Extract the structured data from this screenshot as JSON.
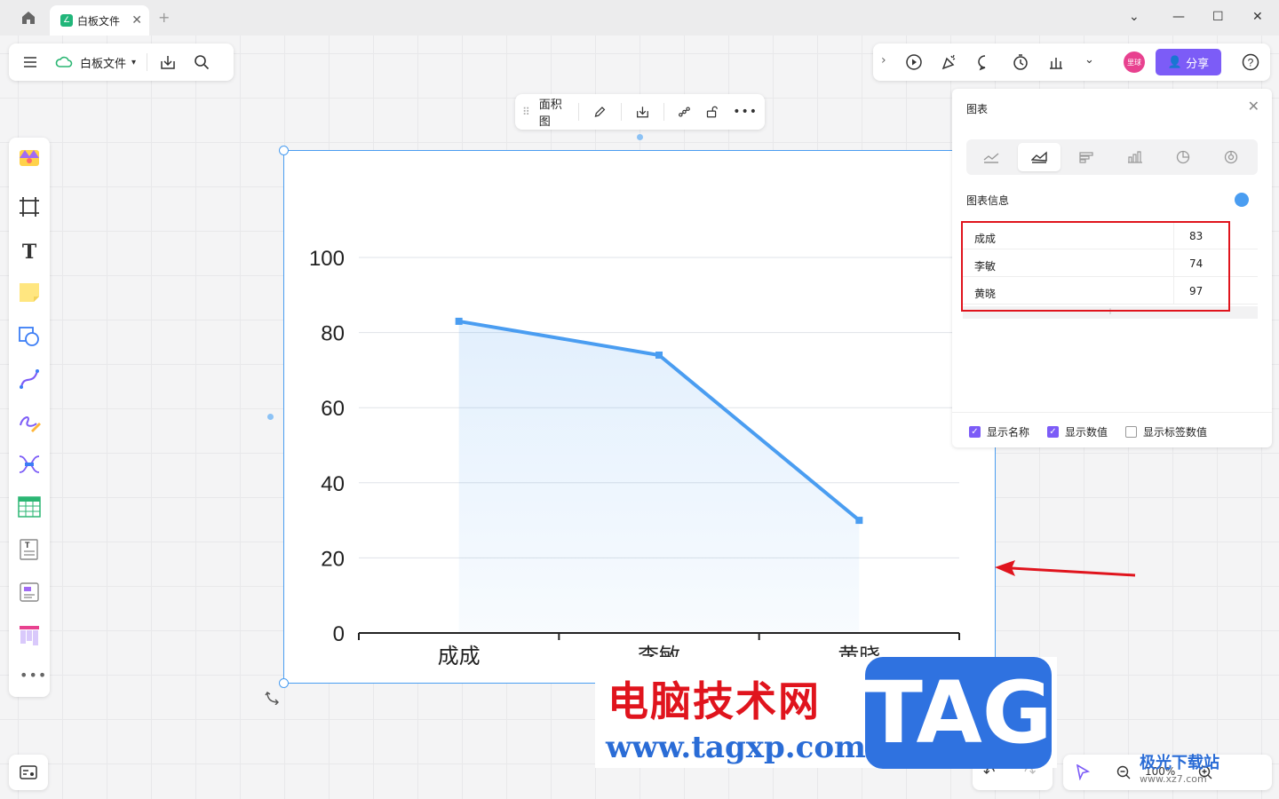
{
  "tab": {
    "title": "白板文件"
  },
  "toolbar": {
    "file_name": "白板文件",
    "share_label": "分享",
    "avatar_text": "里球"
  },
  "chart_toolbar": {
    "type_label": "面积图"
  },
  "panel": {
    "title": "图表",
    "info_label": "图表信息",
    "rows": [
      {
        "name": "成成",
        "value": "83"
      },
      {
        "name": "李敏",
        "value": "74"
      },
      {
        "name": "黄晓",
        "value": "97"
      }
    ],
    "add_row": "+",
    "checkboxes": [
      {
        "label": "显示名称",
        "checked": true
      },
      {
        "label": "显示数值",
        "checked": true
      },
      {
        "label": "显示标签数值",
        "checked": false
      }
    ]
  },
  "zoom": {
    "level": "100%"
  },
  "chart_data": {
    "type": "area",
    "categories": [
      "成成",
      "李敏",
      "黄晓"
    ],
    "values": [
      83,
      74,
      30
    ],
    "ylim": [
      0,
      100
    ],
    "yticks": [
      "0",
      "20",
      "40",
      "60",
      "80",
      "100"
    ],
    "color": "#4a9df1",
    "grid": true
  },
  "watermark": {
    "cn": "电脑技术网",
    "url": "www.tagxp.com",
    "tag": "TAG",
    "site2": "极光下载站",
    "site2_url": "www.xz7.com"
  },
  "colors": {
    "accent": "#7c5cf7",
    "chart_line": "#4a9df1",
    "highlight": "#e0141d"
  }
}
